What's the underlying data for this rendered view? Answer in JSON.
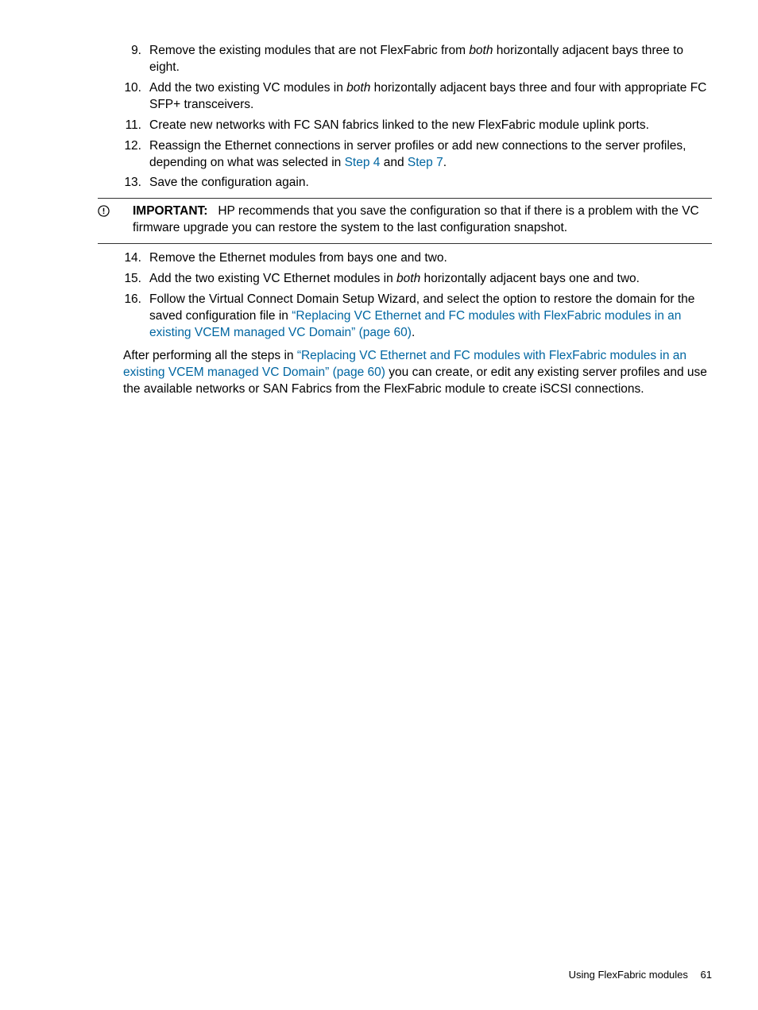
{
  "items": [
    {
      "n": "9.",
      "pre": "Remove the existing modules that are not FlexFabric from ",
      "it": "both",
      "post": " horizontally adjacent bays three to eight."
    },
    {
      "n": "10.",
      "pre": "Add the two existing VC modules in ",
      "it": "both",
      "post": " horizontally adjacent bays three and four with appropriate FC SFP+ transceivers."
    },
    {
      "n": "11.",
      "text": "Create new networks with FC SAN fabrics linked to the new FlexFabric module uplink ports."
    },
    {
      "n": "12.",
      "pre": "Reassign the Ethernet connections in server profiles or add new connections to the server profiles, depending on what was selected in ",
      "link1": "Step 4",
      "mid": " and ",
      "link2": "Step 7",
      "post": "."
    },
    {
      "n": "13.",
      "text": "Save the configuration again."
    }
  ],
  "important": {
    "label": "IMPORTANT:",
    "text": "HP recommends that you save the configuration so that if there is a problem with the VC firmware upgrade you can restore the system to the last configuration snapshot."
  },
  "items2": [
    {
      "n": "14.",
      "text": "Remove the Ethernet modules from bays one and two."
    },
    {
      "n": "15.",
      "pre": "Add the two existing VC Ethernet modules in ",
      "it": "both",
      "post": " horizontally adjacent bays one and two."
    },
    {
      "n": "16.",
      "pre": "Follow the Virtual Connect Domain Setup Wizard, and select the option to restore the domain for the saved configuration file in ",
      "link1": "“Replacing VC Ethernet and FC modules with FlexFabric modules in an existing VCEM managed VC Domain” (page 60)",
      "post": "."
    }
  ],
  "after": {
    "pre": "After performing all the steps in ",
    "link": "“Replacing VC Ethernet and FC modules with FlexFabric modules in an existing VCEM managed VC Domain” (page 60)",
    "post": " you can create, or edit any existing server profiles and use the available networks or SAN Fabrics from the FlexFabric module to create iSCSI connections."
  },
  "footer": {
    "section": "Using FlexFabric modules",
    "page": "61"
  }
}
